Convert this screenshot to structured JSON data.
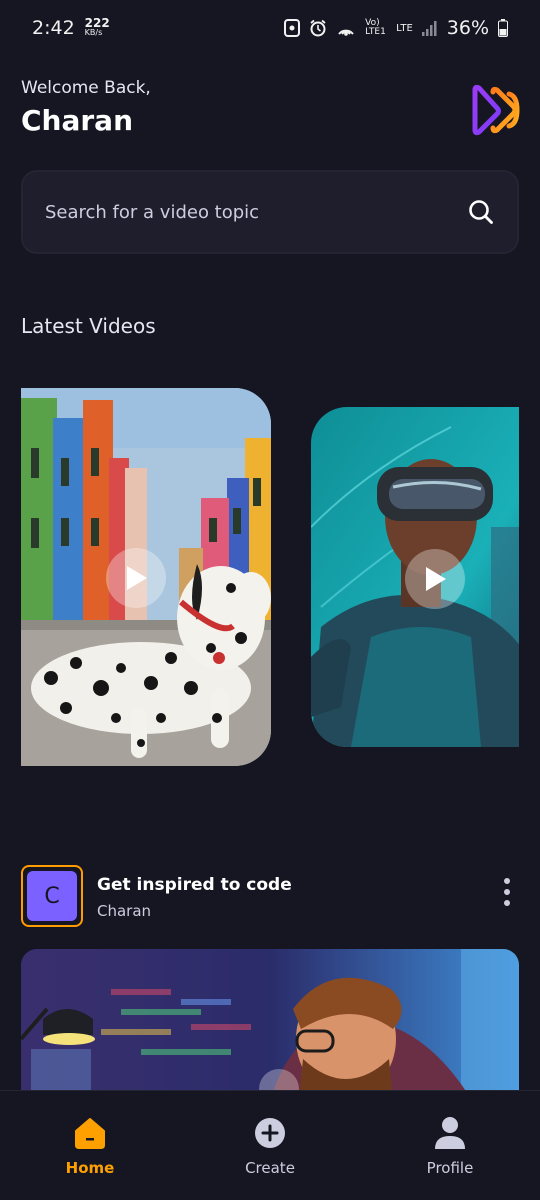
{
  "status_bar": {
    "time": "2:42",
    "speed_value": "222",
    "speed_unit": "KB/s",
    "network_label": "Vo) LTE1",
    "lte_label": "LTE",
    "battery": "36%"
  },
  "header": {
    "welcome": "Welcome Back,",
    "username": "Charan",
    "logo_icon": "app-logo-icon"
  },
  "search": {
    "placeholder": "Search  for a video topic",
    "icon": "search-icon"
  },
  "latest": {
    "title": "Latest Videos",
    "videos": [
      {
        "subject": "dalmatian dog",
        "icon": "play-icon"
      },
      {
        "subject": "vr headset person",
        "icon": "play-icon"
      }
    ]
  },
  "post": {
    "avatar_letter": "C",
    "title": "Get inspired to code",
    "author": "Charan",
    "menu_icon": "more-vertical-icon"
  },
  "nav": {
    "items": [
      {
        "label": "Home",
        "icon": "home-icon",
        "active": true
      },
      {
        "label": "Create",
        "icon": "plus-circle-icon",
        "active": false
      },
      {
        "label": "Profile",
        "icon": "profile-icon",
        "active": false
      }
    ]
  },
  "colors": {
    "background": "#161622",
    "surface": "#1e1e2d",
    "accent": "#ffa001",
    "avatar": "#7b61ff"
  }
}
